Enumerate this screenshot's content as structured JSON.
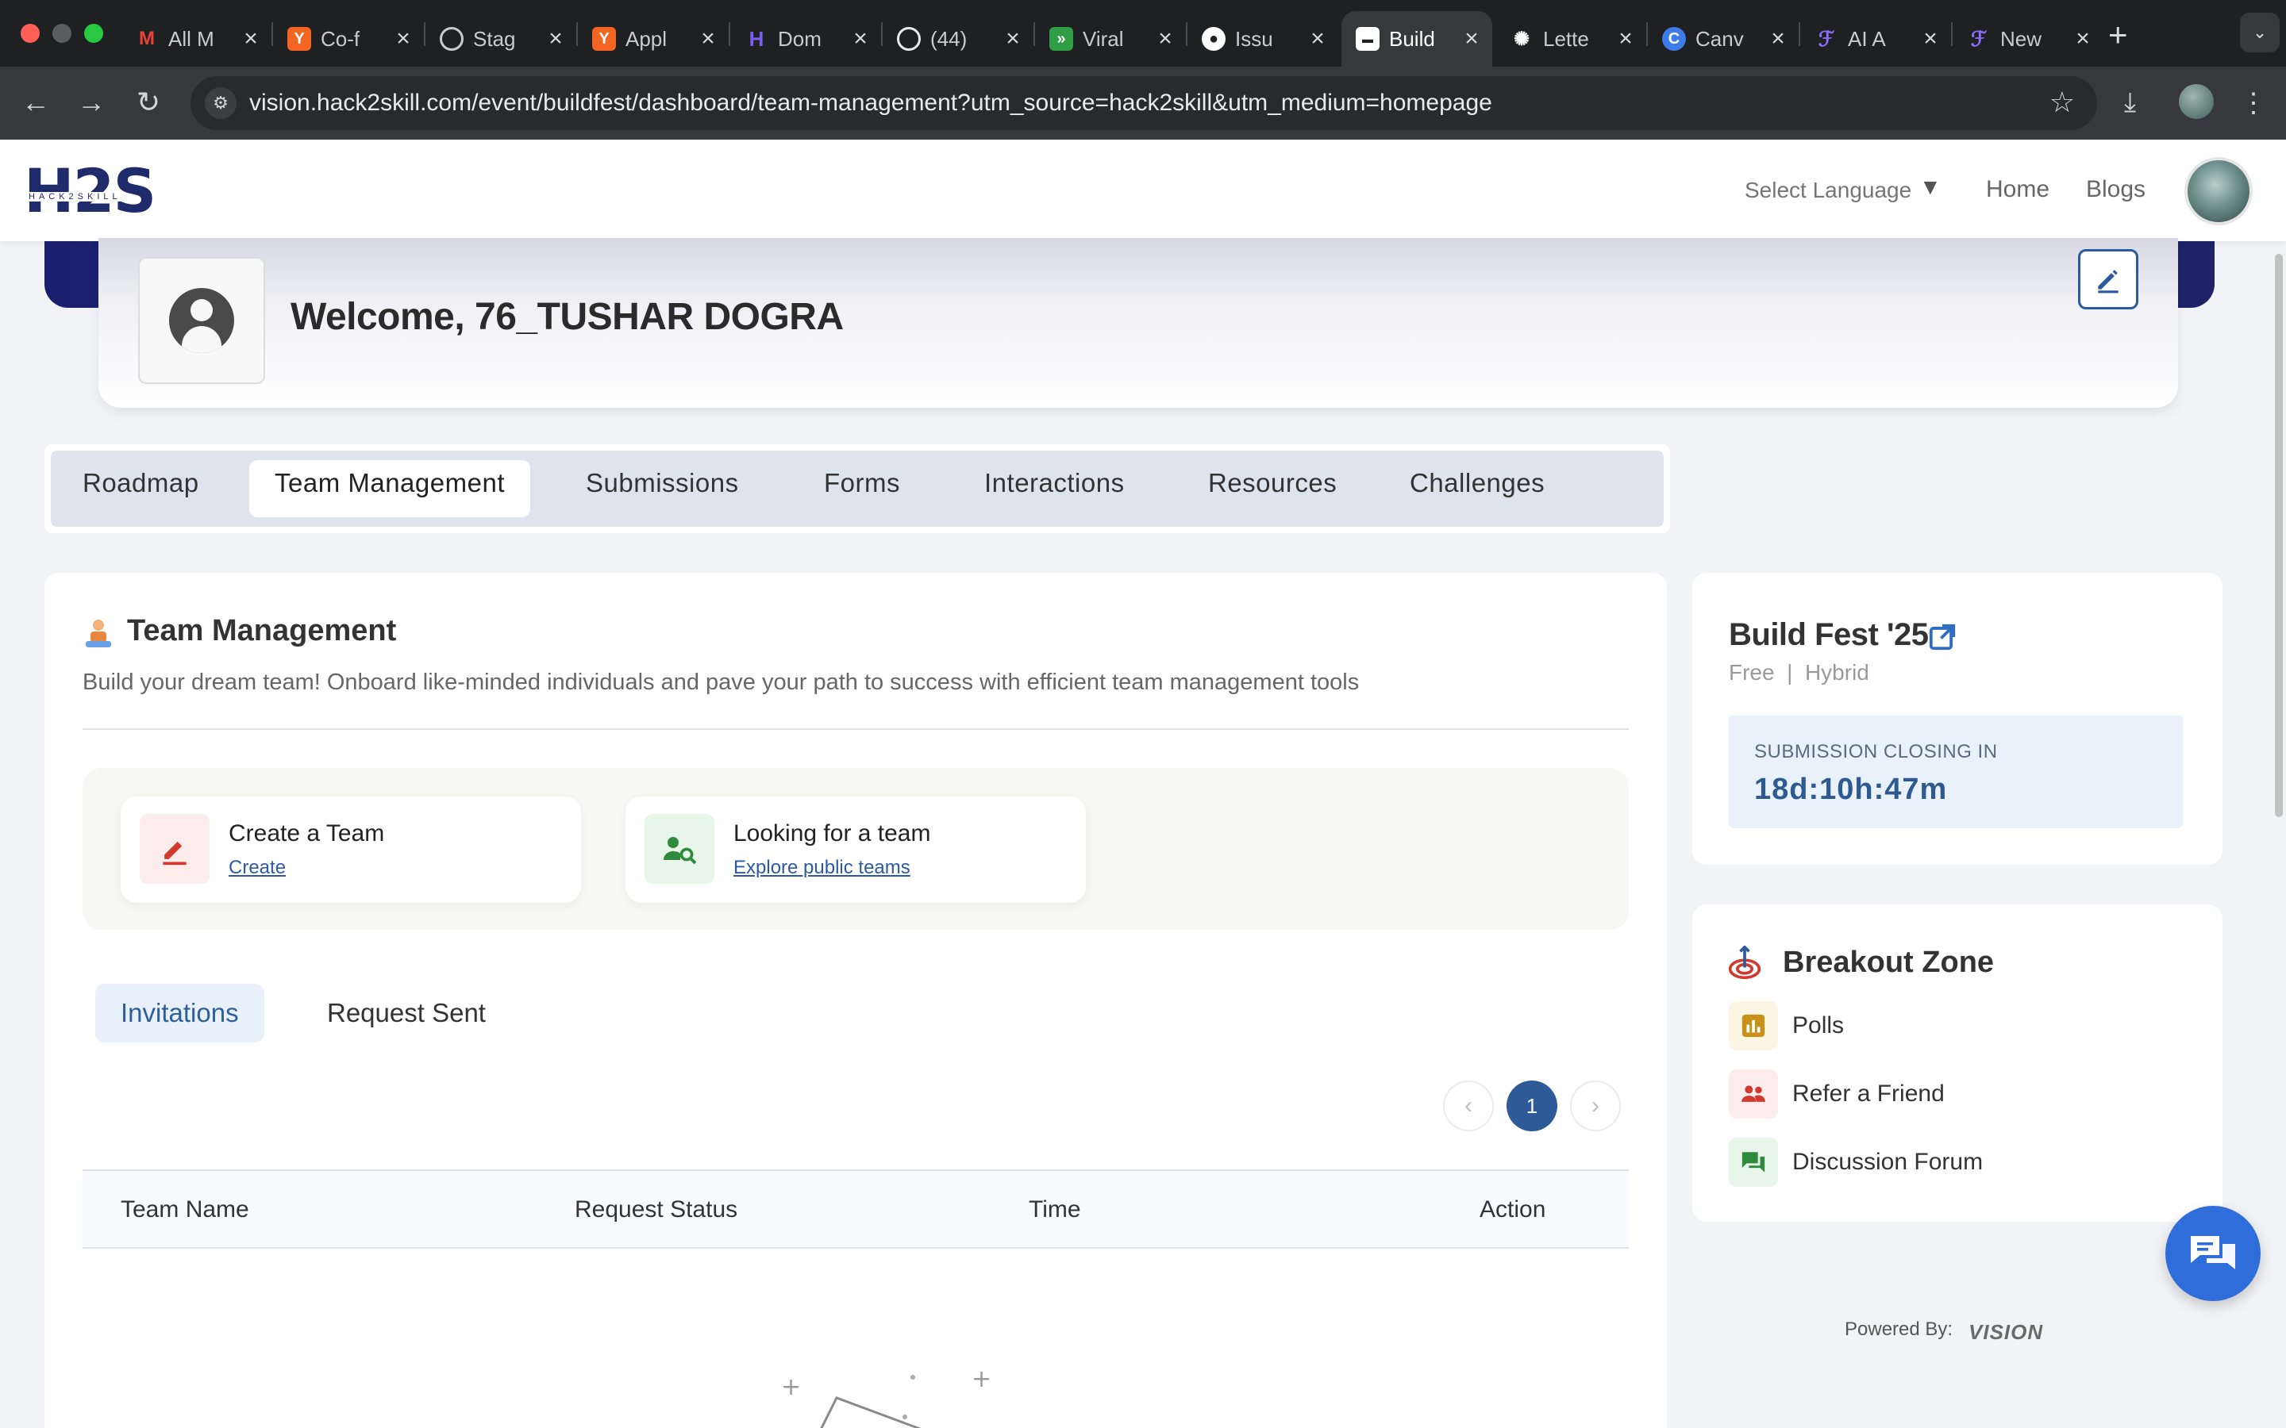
{
  "browser": {
    "tabs": [
      {
        "title": "All M",
        "favicon": "gmail-icon",
        "color": "#ea4335",
        "active": false
      },
      {
        "title": "Co-f",
        "favicon": "ycombinator-icon",
        "color": "#f26522",
        "active": false
      },
      {
        "title": "Stag",
        "favicon": "globe-icon",
        "color": "#9aa0a6",
        "active": false
      },
      {
        "title": "Appl",
        "favicon": "ycombinator-icon",
        "color": "#f26522",
        "active": false
      },
      {
        "title": "Dom",
        "favicon": "dom-icon",
        "color": "#6f4de0",
        "active": false
      },
      {
        "title": "(44)",
        "favicon": "whatsapp-icon",
        "color": "#25d366",
        "active": false
      },
      {
        "title": "Viral",
        "favicon": "viral-icon",
        "color": "#3fb950",
        "active": false
      },
      {
        "title": "Issu",
        "favicon": "github-icon",
        "color": "#ffffff",
        "active": false
      },
      {
        "title": "Build",
        "favicon": "build-icon",
        "color": "#ffffff",
        "active": true
      },
      {
        "title": "Lette",
        "favicon": "openai-icon",
        "color": "#ffffff",
        "active": false
      },
      {
        "title": "Canv",
        "favicon": "canva-icon",
        "color": "#3d7be8",
        "active": false
      },
      {
        "title": "AI A",
        "favicon": "ai-icon",
        "color": "#7a5cff",
        "active": false
      },
      {
        "title": "New",
        "favicon": "ai-icon",
        "color": "#7a5cff",
        "active": false
      }
    ],
    "url": "vision.hack2skill.com/event/buildfest/dashboard/team-management?utm_source=hack2skill&utm_medium=homepage"
  },
  "header": {
    "logo_text": "H2S",
    "logo_subtext": "HACK2SKILL",
    "language_label": "Select Language",
    "nav": [
      "Home",
      "Blogs"
    ]
  },
  "welcome": {
    "text": "Welcome, 76_TUSHAR DOGRA"
  },
  "tabs": [
    "Roadmap",
    "Team Management",
    "Submissions",
    "Forms",
    "Interactions",
    "Resources",
    "Challenges"
  ],
  "active_tab": "Team Management",
  "team_management": {
    "title": "Team Management",
    "description": "Build your dream team! Onboard like-minded individuals and pave your path to success with efficient team management tools",
    "cards": [
      {
        "heading": "Create a Team",
        "link": "Create"
      },
      {
        "heading": "Looking for a team",
        "link": "Explore public teams"
      }
    ],
    "subtabs": [
      "Invitations",
      "Request Sent"
    ],
    "active_subtab": "Invitations",
    "pagination": {
      "current": "1",
      "prev": "‹",
      "next": "›"
    },
    "columns": [
      "Team Name",
      "Request Status",
      "Time",
      "Action"
    ]
  },
  "event": {
    "title": "Build Fest '25",
    "meta": "Free  |  Hybrid",
    "closing_label": "SUBMISSION CLOSING IN",
    "countdown": "18d:10h:47m"
  },
  "breakout": {
    "title": "Breakout Zone",
    "items": [
      {
        "label": "Polls",
        "icon": "poll-icon"
      },
      {
        "label": "Refer a Friend",
        "icon": "refer-icon"
      },
      {
        "label": "Discussion Forum",
        "icon": "forum-icon"
      }
    ]
  },
  "footer": {
    "powered_by": "Powered By:",
    "brand": "VISION"
  },
  "colors": {
    "primary": "#2f5a98",
    "hero": "#22257a",
    "chat": "#2f6ddb"
  }
}
